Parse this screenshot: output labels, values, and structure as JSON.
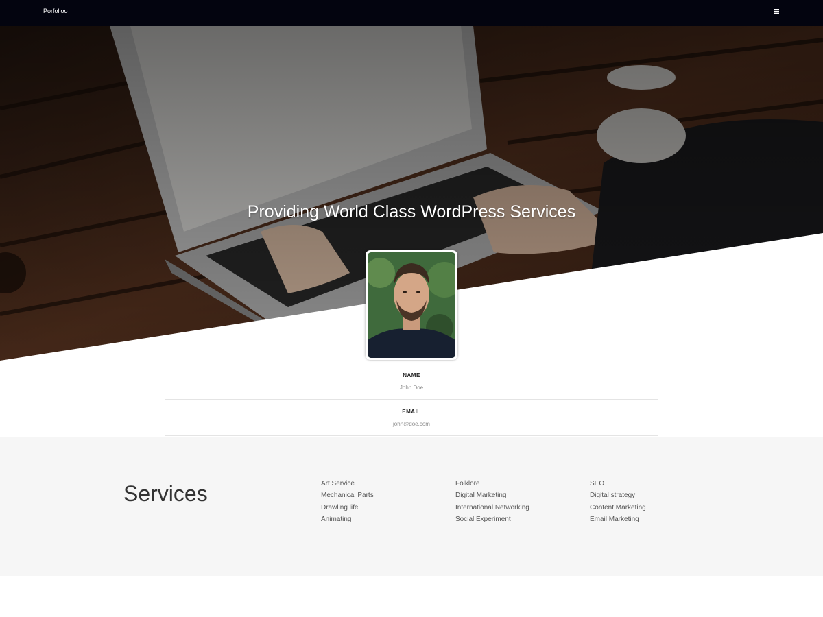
{
  "header": {
    "brand": "Porfolioo",
    "menu_icon": "hamburger-menu-icon"
  },
  "hero": {
    "title": "Providing World Class WordPress Services"
  },
  "profile": {
    "fields": [
      {
        "label": "NAME",
        "value": "John Doe"
      },
      {
        "label": "EMAIL",
        "value": "john@doe.com"
      }
    ]
  },
  "services": {
    "title": "Services",
    "columns": [
      [
        "Art Service",
        "Mechanical Parts",
        "Drawling life",
        "Animating"
      ],
      [
        "Folklore",
        "Digital Marketing",
        "International Networking",
        "Social Experiment"
      ],
      [
        "SEO",
        "Digital strategy",
        "Content Marketing",
        "Email Marketing"
      ]
    ]
  }
}
